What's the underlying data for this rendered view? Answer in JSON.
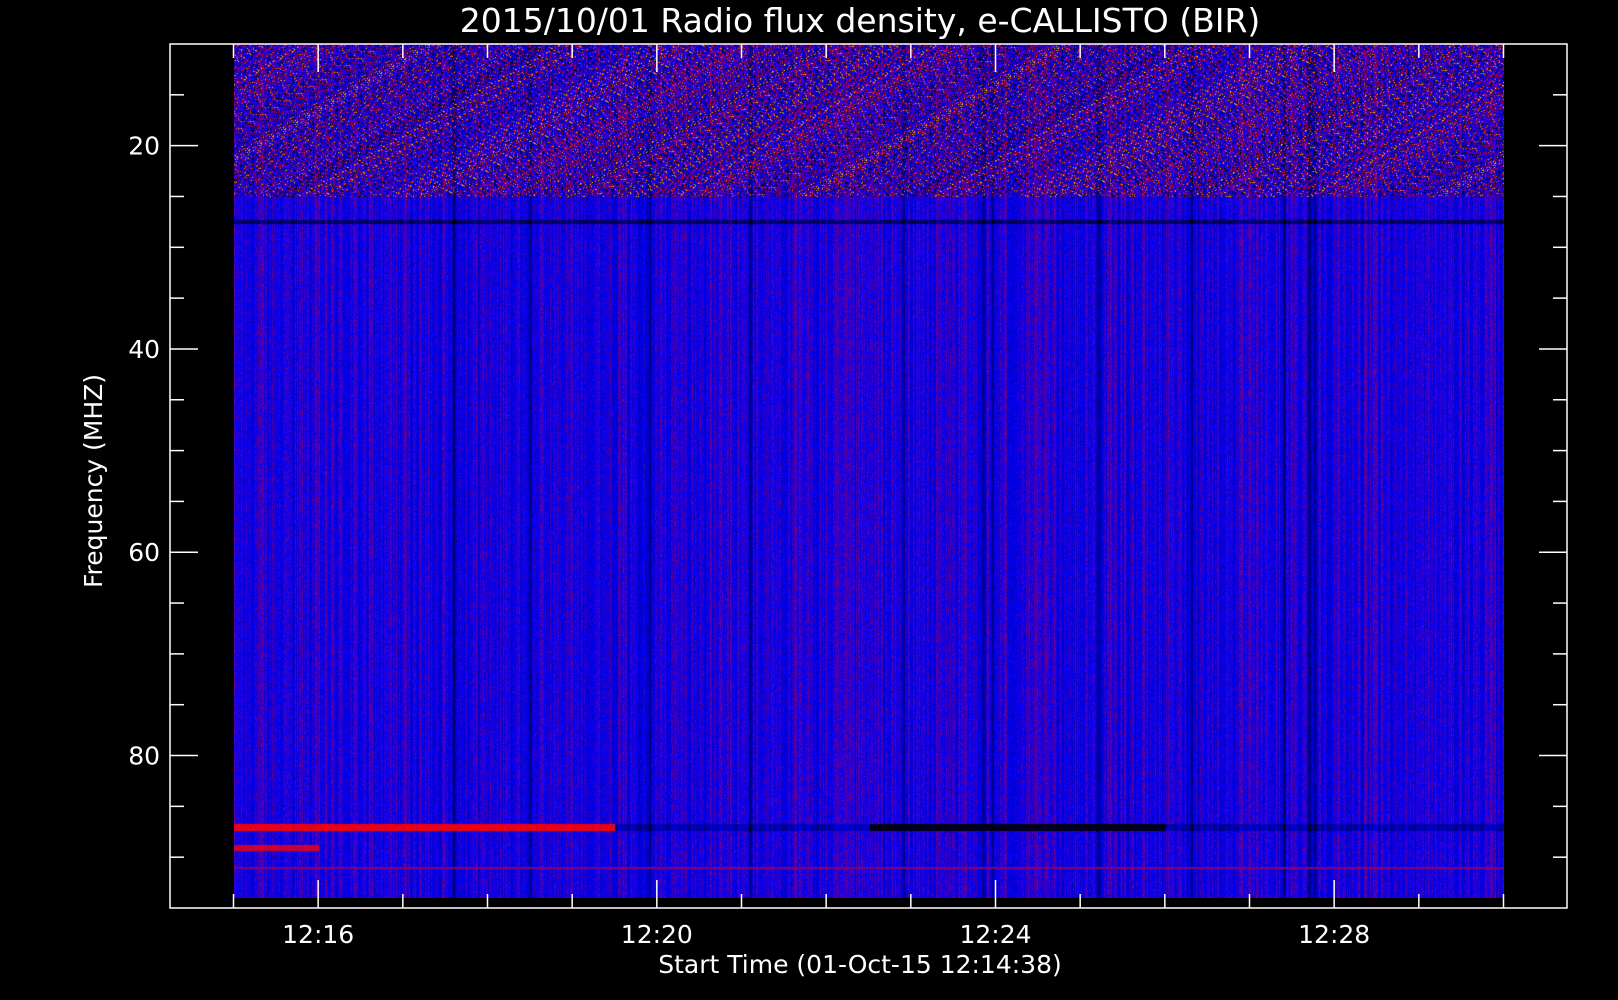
{
  "chart_data": {
    "type": "heatmap",
    "title": "2015/10/01  Radio flux density, e-CALLISTO (BIR)",
    "xlabel": "Start Time (01-Oct-15 12:14:38)",
    "ylabel": "Frequency (MHZ)",
    "x_ticks": [
      "12:16",
      "12:20",
      "12:24",
      "12:28"
    ],
    "x_tick_values_min": [
      16,
      20,
      24,
      28
    ],
    "y_ticks": [
      "20",
      "40",
      "60",
      "80"
    ],
    "y_tick_values": [
      20,
      40,
      60,
      80
    ],
    "xlim_min": [
      14.25,
      30.75
    ],
    "data_xlim_min": [
      15.0,
      30.0
    ],
    "ylim": [
      10.0,
      95.0
    ],
    "data_ylim": [
      10.0,
      94.0
    ],
    "y_inverted": true,
    "grid": false,
    "colors": {
      "background": "#000000",
      "foreground": "#ffffff",
      "low": "#000000",
      "mid": "#0000ff",
      "high": "#ff0000",
      "peak": "#ffff00"
    },
    "features": [
      {
        "kind": "rfi-band",
        "freq_range": [
          10,
          25
        ],
        "intensity": "high"
      },
      {
        "kind": "line",
        "freq": 27.5,
        "intensity": "low"
      },
      {
        "kind": "band",
        "freq": 87,
        "time_range_min": [
          15.0,
          19.5
        ],
        "intensity": "high"
      },
      {
        "kind": "band",
        "freq": 87,
        "time_range_min": [
          22.5,
          26.0
        ],
        "intensity": "low"
      },
      {
        "kind": "band",
        "freq": 89,
        "time_range_min": [
          15.0,
          16.0
        ],
        "intensity": "high"
      },
      {
        "kind": "band",
        "freq": 91,
        "time_range_min": [
          15.0,
          30.0
        ],
        "intensity": "medium"
      }
    ]
  }
}
